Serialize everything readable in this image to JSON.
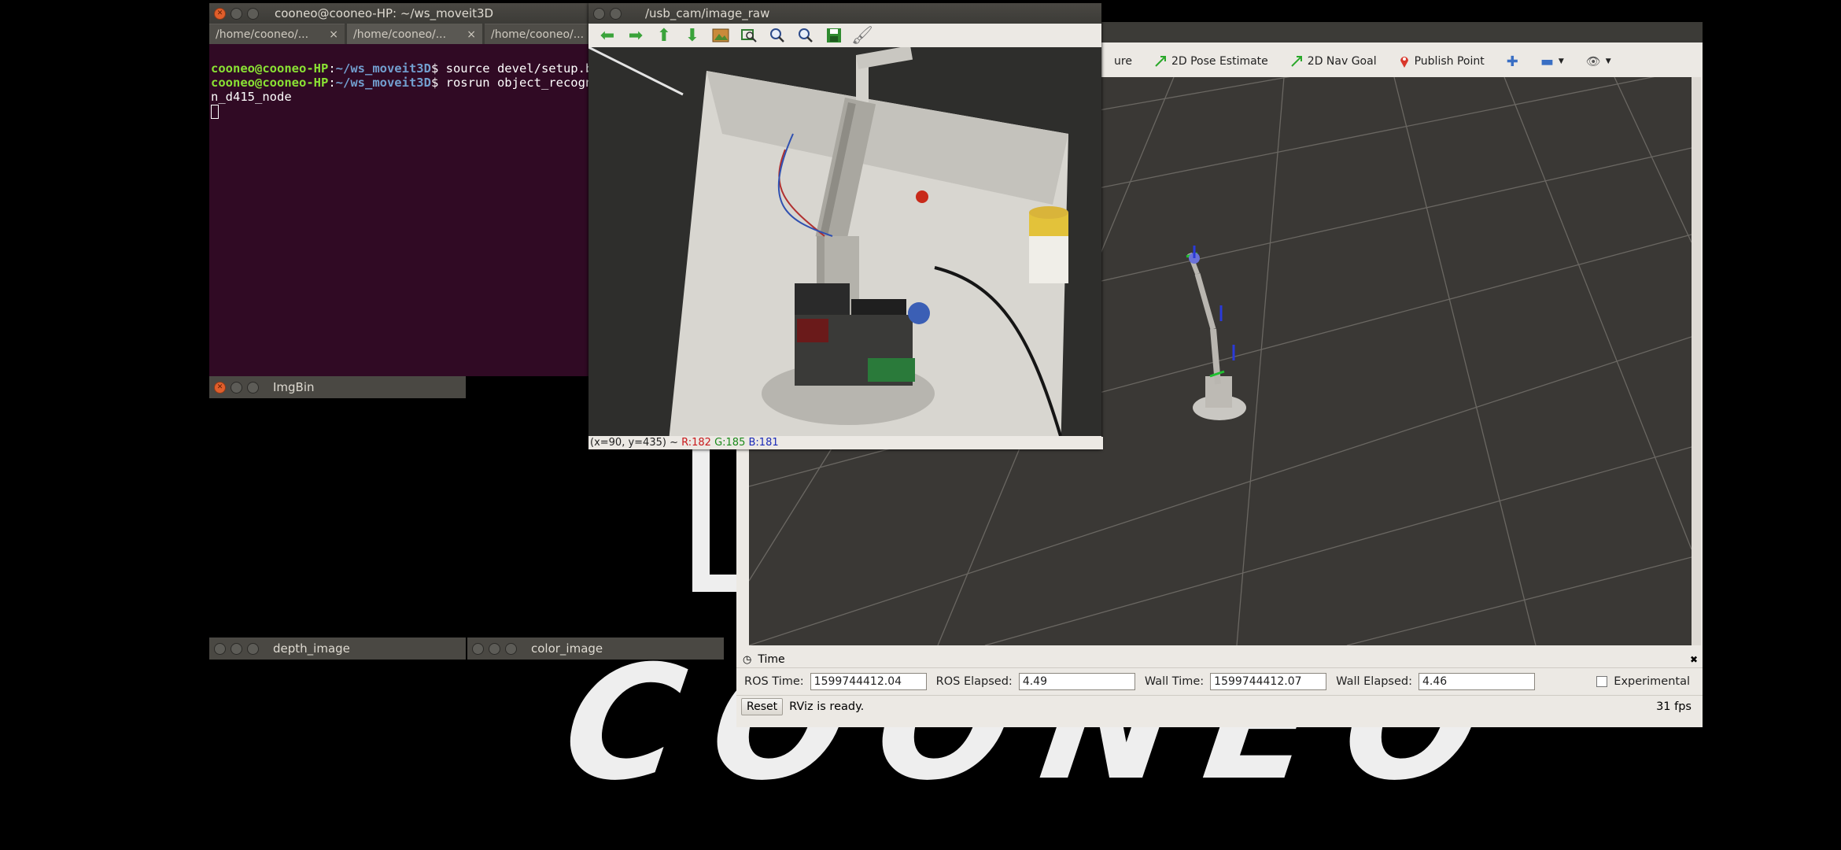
{
  "wallpaper": {
    "logo_text": "COONEO"
  },
  "terminal": {
    "title": "cooneo@cooneo-HP: ~/ws_moveit3D",
    "tabs": [
      "/home/cooneo/...",
      "/home/cooneo/...",
      "/home/cooneo/..."
    ],
    "lines": [
      {
        "user": "cooneo@cooneo-HP",
        "path": "~/ws_moveit3D",
        "cmd": "$ source devel/setup.b"
      },
      {
        "user": "cooneo@cooneo-HP",
        "path": "~/ws_moveit3D",
        "cmd": "$ rosrun object_recogn"
      },
      {
        "text": "n_d415_node"
      }
    ]
  },
  "imgbin": {
    "title": "ImgBin"
  },
  "depth_window": {
    "title": "depth_image"
  },
  "color_window": {
    "title": "color_image"
  },
  "image_viewer": {
    "title": "/usb_cam/image_raw",
    "toolbar_icons": [
      "arrow-left-icon",
      "arrow-right-icon",
      "arrow-up-icon",
      "arrow-down-icon",
      "image-icon",
      "zoom-fit-icon",
      "zoom-in-icon",
      "zoom-out-icon",
      "save-icon",
      "brush-icon"
    ],
    "status": {
      "coords": "(x=90, y=435) ~",
      "r": "R:182",
      "g": "G:185",
      "b": "B:181"
    }
  },
  "rviz": {
    "tools": [
      {
        "label": "ure",
        "icon": "interact-icon"
      },
      {
        "label": "2D Pose Estimate",
        "icon": "pose-arrow-icon"
      },
      {
        "label": "2D Nav Goal",
        "icon": "nav-arrow-icon"
      },
      {
        "label": "Publish Point",
        "icon": "map-pin-icon"
      }
    ],
    "time_panel": {
      "title": "Time",
      "ros_time_label": "ROS Time:",
      "ros_time": "1599744412.04",
      "ros_elapsed_label": "ROS Elapsed:",
      "ros_elapsed": "4.49",
      "wall_time_label": "Wall Time:",
      "wall_time": "1599744412.07",
      "wall_elapsed_label": "Wall Elapsed:",
      "wall_elapsed": "4.46",
      "experimental_label": "Experimental"
    },
    "status": {
      "reset_label": "Reset",
      "message": "RViz is ready.",
      "fps": "31 fps"
    }
  }
}
